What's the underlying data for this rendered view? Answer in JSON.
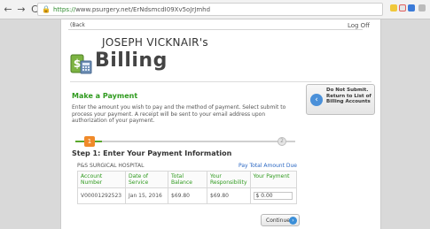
{
  "browser": {
    "back_icon": "←",
    "forward_icon": "→",
    "reload_icon": "C",
    "home_icon": "⌂",
    "url_https": "https://",
    "url_rest": "www.psurgery.net/ErNdsmcdI09Xv5oJrJmhd"
  },
  "page": {
    "back_text": "(Back",
    "logoff": "Log Off"
  },
  "header": {
    "owner": "JOSEPH VICKNAIR's",
    "title": "Billing"
  },
  "payment": {
    "section_title": "Make a Payment",
    "instructions": "Enter the amount you wish to pay and the method of payment. Select submit to process your payment. A receipt will be sent to your email address upon authorization of your payment.",
    "step_label": "Step 1: Enter Your Payment Information",
    "step_current": "1",
    "step_next": "2",
    "progress_fraction": 0.12,
    "hospital": "P&S SURGICAL HOSPITAL",
    "pay_total_link": "Pay Total Amount Due",
    "columns": [
      "Account Number",
      "Date of Service",
      "Total Balance",
      "Your Responsibility",
      "Your Payment"
    ],
    "rows": [
      {
        "account": "V00001292523",
        "date": "Jan 15, 2016",
        "total": "$69.80",
        "responsibility": "$69.80",
        "payment": "$ 0.00"
      }
    ],
    "continue_label": "Continue"
  },
  "sidebar": {
    "submit_text": "Do Not Submit. Return to List of Billing Accounts"
  }
}
